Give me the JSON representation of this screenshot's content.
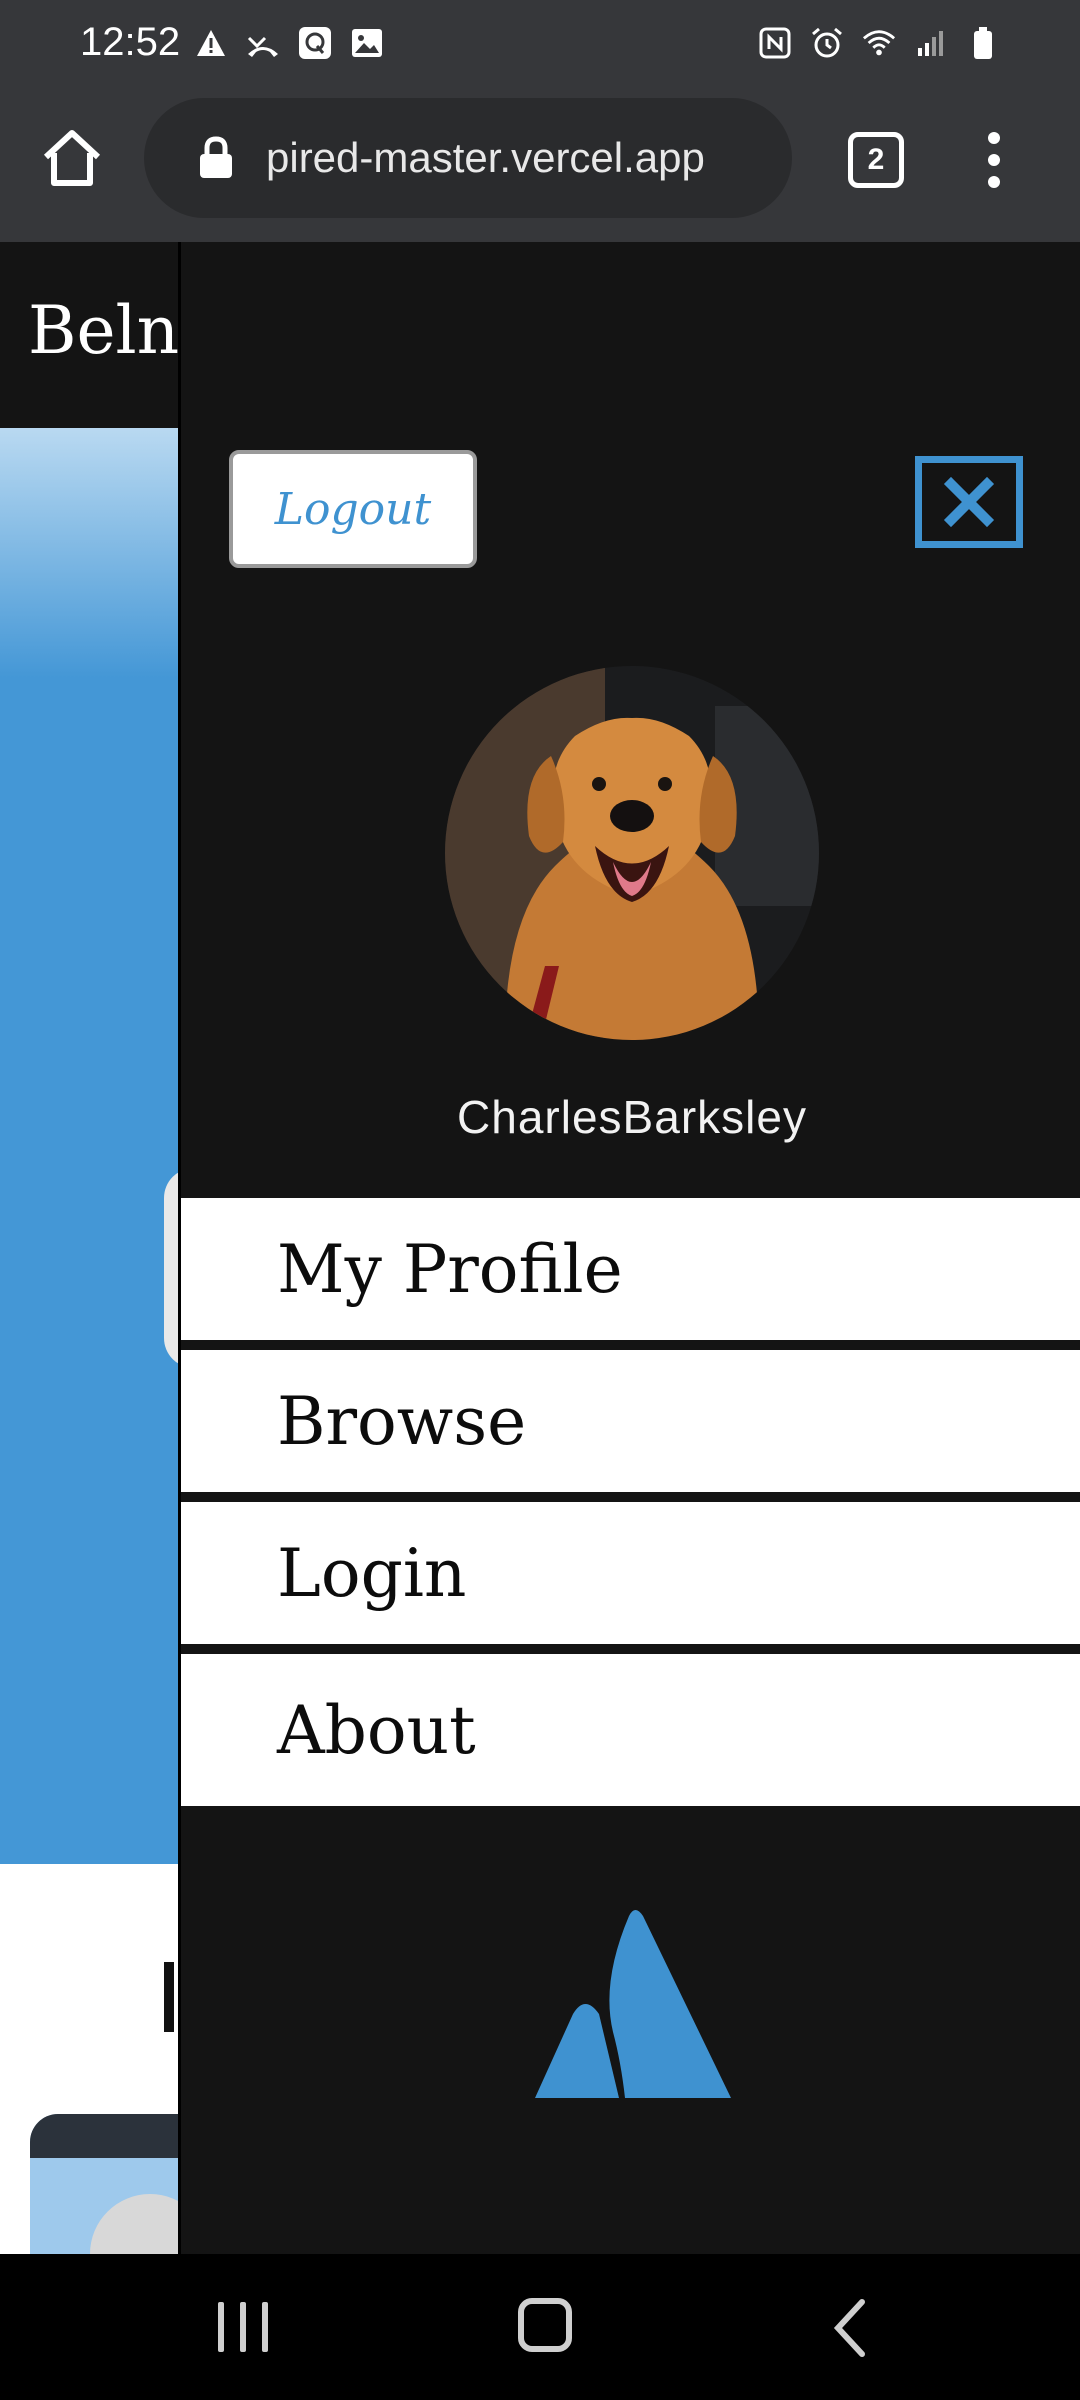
{
  "status_bar": {
    "time": "12:52",
    "left_icons": [
      "warning-icon",
      "missed-call-icon",
      "quora-icon",
      "image-icon"
    ],
    "right_icons": [
      "nfc-icon",
      "alarm-icon",
      "wifi-icon",
      "signal-icon",
      "battery-icon"
    ]
  },
  "browser": {
    "url": "pired-master.vercel.app",
    "tab_count": "2"
  },
  "background_page": {
    "header_title": "Beln"
  },
  "drawer": {
    "logout_label": "Logout",
    "username": "CharlesBarksley",
    "nav_items": [
      {
        "label": "My Profile"
      },
      {
        "label": "Browse"
      },
      {
        "label": "Login"
      },
      {
        "label": "About"
      }
    ]
  },
  "colors": {
    "accent": "#3f92d0",
    "drawer_bg": "#141414",
    "hero_blue": "#4497d6"
  }
}
